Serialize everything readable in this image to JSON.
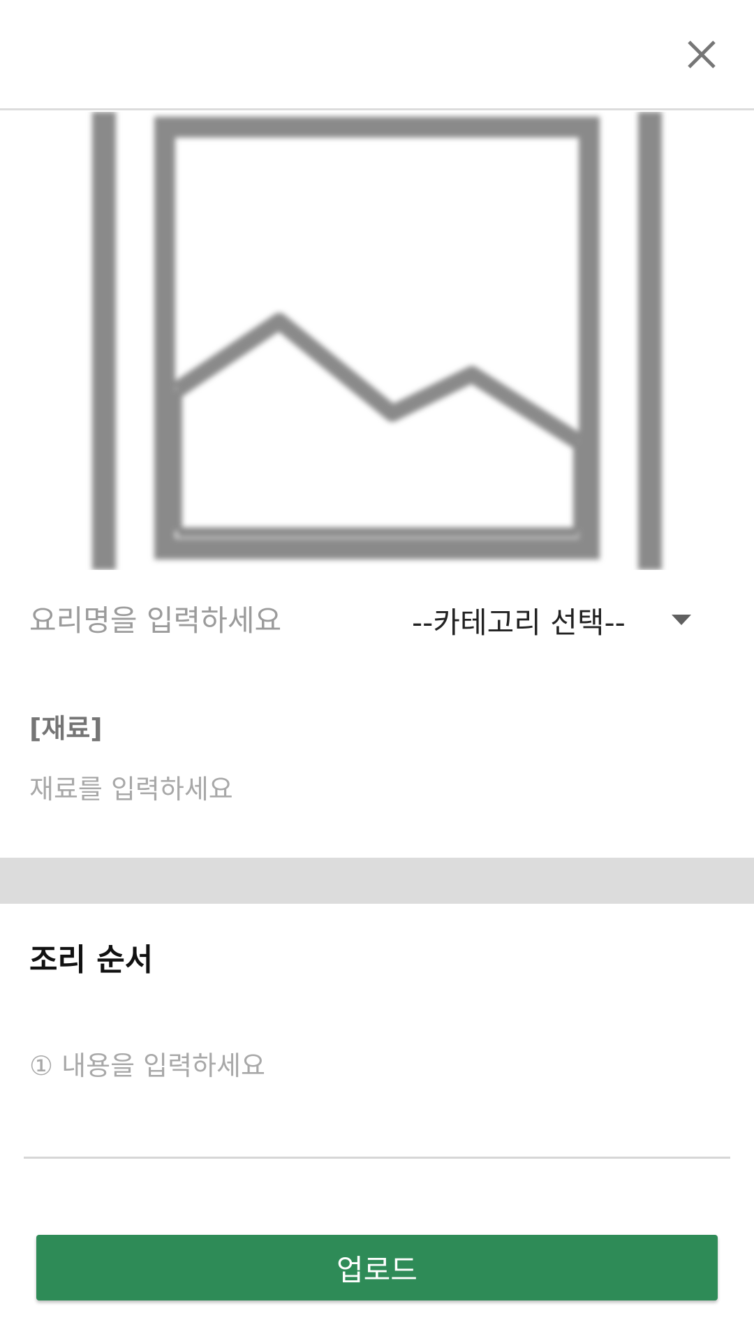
{
  "header": {
    "close_icon": "close-icon"
  },
  "photo": {
    "icon": "image-placeholder-icon"
  },
  "recipe_form": {
    "dish_name_placeholder": "요리명을 입력하세요",
    "dish_name_value": "",
    "category_selected": "--카테고리 선택--",
    "category_caret_icon": "caret-down-icon",
    "ingredients_title": "[재료]",
    "ingredients_placeholder": "재료를 입력하세요",
    "ingredients_value": "",
    "steps_title": "조리 순서",
    "step_placeholder": "① 내용을 입력하세요",
    "step_value": ""
  },
  "actions": {
    "upload_label": "업로드"
  },
  "colors": {
    "accent": "#2e8b57",
    "section_band": "#dcdcdc",
    "placeholder_text": "#9b9b9b",
    "icon_gray": "#767676"
  }
}
